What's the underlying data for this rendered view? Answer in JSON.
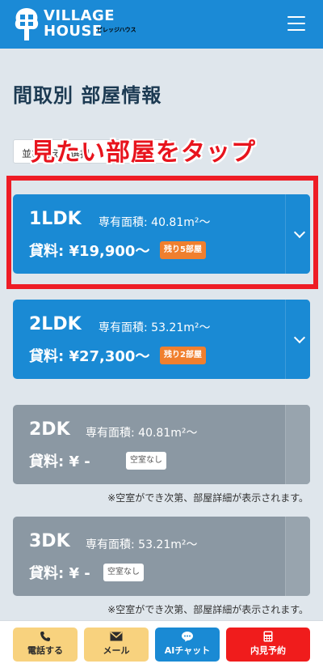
{
  "header": {
    "logo_line1": "VILLAGE",
    "logo_line2": "HOUSE",
    "logo_sub": "ビレッジハウス"
  },
  "page_title": "間取別 部屋情報",
  "sort_label": "並び替えの選択",
  "annotation": "見たい部屋をタップ",
  "rooms": [
    {
      "type": "1LDK",
      "area": "専有面積: 40.81m²〜",
      "rent": "貸料: ¥19,900〜",
      "badge": "残り5部屋"
    },
    {
      "type": "2LDK",
      "area": "専有面積: 53.21m²〜",
      "rent": "貸料: ¥27,300〜",
      "badge": "残り2部屋"
    },
    {
      "type": "2DK",
      "area": "専有面積: 40.81m²〜",
      "rent": "貸料: ¥ -",
      "badge": "空室なし",
      "note": "※空室ができ次第、部屋詳細が表示されます。"
    },
    {
      "type": "3DK",
      "area": "専有面積: 53.21m²〜",
      "rent": "貸料: ¥ -",
      "badge": "空室なし",
      "note": "※空室ができ次第、部屋詳細が表示されます。"
    }
  ],
  "bottom_bar": {
    "call": "電話する",
    "mail": "メール",
    "ai": "AIチャット",
    "visit": "内見予約"
  },
  "colors": {
    "brand_blue": "#1a8ad4",
    "unavailable_gray": "#8b98a3",
    "badge_orange": "#f07f2e",
    "annotation_red": "#ee1c25"
  }
}
